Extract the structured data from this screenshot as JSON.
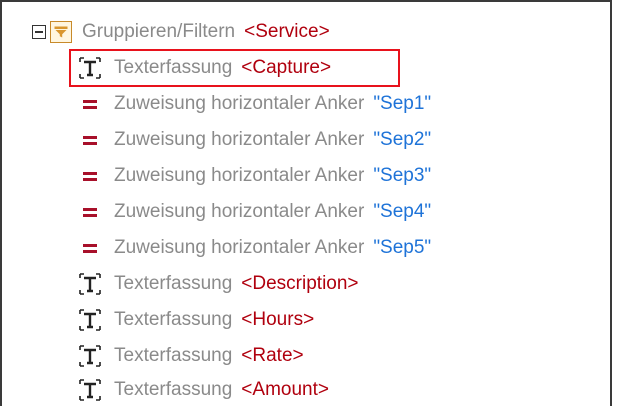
{
  "root": {
    "label": "Gruppieren/Filtern",
    "tag": "<Service>",
    "expander_icon": "collapse-minus-icon",
    "node_icon": "group-filter-icon"
  },
  "items": [
    {
      "kind": "text",
      "label": "Texterfassung",
      "value": "<Capture>",
      "icon": "text-capture-icon",
      "selected": true
    },
    {
      "kind": "anchor",
      "label": "Zuweisung horizontaler Anker",
      "value": "\"Sep1\"",
      "icon": "assignment-equals-icon"
    },
    {
      "kind": "anchor",
      "label": "Zuweisung horizontaler Anker",
      "value": "\"Sep2\"",
      "icon": "assignment-equals-icon"
    },
    {
      "kind": "anchor",
      "label": "Zuweisung horizontaler Anker",
      "value": "\"Sep3\"",
      "icon": "assignment-equals-icon"
    },
    {
      "kind": "anchor",
      "label": "Zuweisung horizontaler Anker",
      "value": "\"Sep4\"",
      "icon": "assignment-equals-icon"
    },
    {
      "kind": "anchor",
      "label": "Zuweisung horizontaler Anker",
      "value": "\"Sep5\"",
      "icon": "assignment-equals-icon"
    },
    {
      "kind": "text",
      "label": "Texterfassung",
      "value": "<Description>",
      "icon": "text-capture-icon"
    },
    {
      "kind": "text",
      "label": "Texterfassung",
      "value": "<Hours>",
      "icon": "text-capture-icon"
    },
    {
      "kind": "text",
      "label": "Texterfassung",
      "value": "<Rate>",
      "icon": "text-capture-icon"
    },
    {
      "kind": "text",
      "label": "Texterfassung",
      "value": "<Amount>",
      "icon": "text-capture-icon"
    }
  ],
  "colors": {
    "label": "#8a8a8a",
    "tag": "#b0000e",
    "string": "#1e73d8",
    "highlight": "#e8121c"
  }
}
